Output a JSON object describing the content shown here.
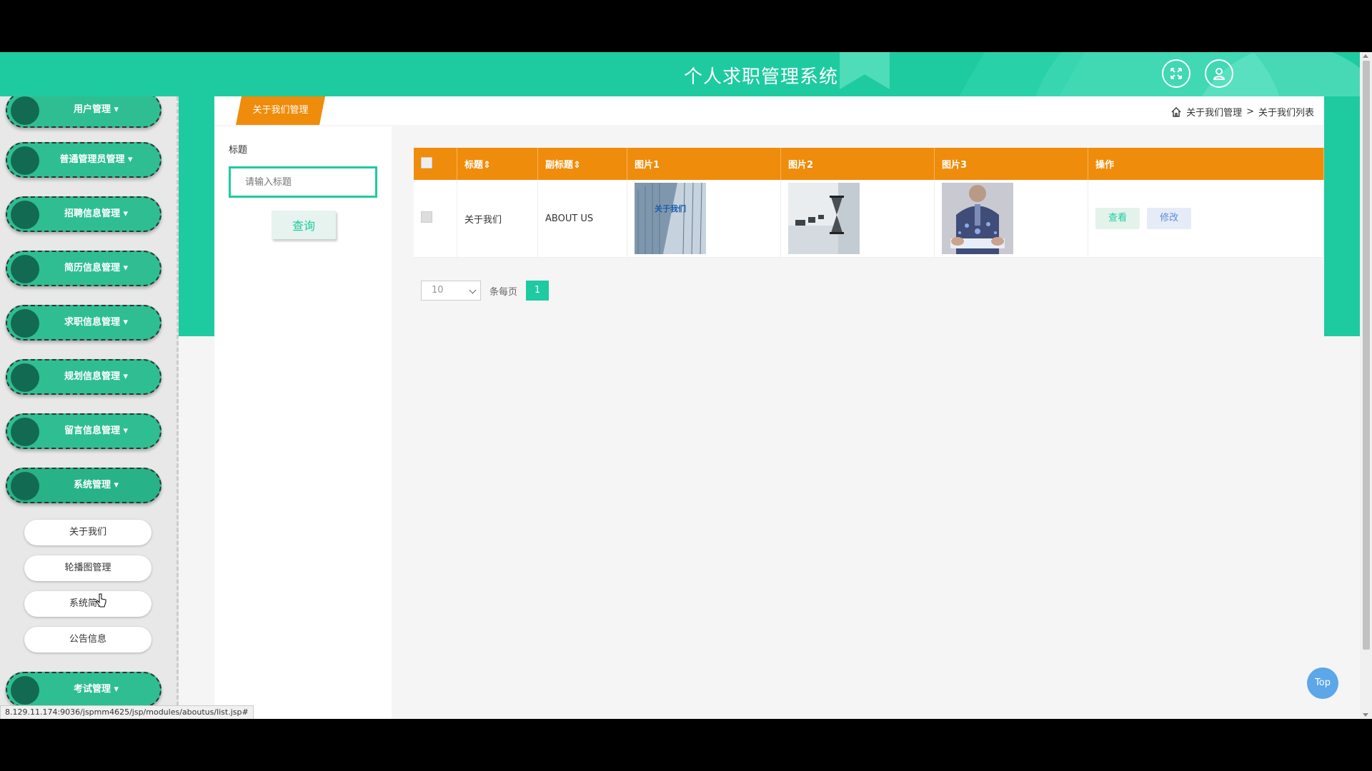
{
  "header": {
    "title": "个人求职管理系统"
  },
  "sidebar": {
    "menus": [
      {
        "label": "用户管理"
      },
      {
        "label": "普通管理员管理"
      },
      {
        "label": "招聘信息管理"
      },
      {
        "label": "简历信息管理"
      },
      {
        "label": "求职信息管理"
      },
      {
        "label": "规划信息管理"
      },
      {
        "label": "留言信息管理"
      },
      {
        "label": "系统管理"
      },
      {
        "label": "考试管理"
      }
    ],
    "submenu": [
      {
        "label": "关于我们"
      },
      {
        "label": "轮播图管理"
      },
      {
        "label": "系统简介"
      },
      {
        "label": "公告信息"
      }
    ]
  },
  "main": {
    "tab": "关于我们管理",
    "breadcrumb": {
      "level1": "关于我们管理",
      "sep": ">",
      "level2": "关于我们列表"
    },
    "filter": {
      "label": "标题",
      "placeholder": "请输入标题",
      "button": "查询"
    },
    "table": {
      "headers": [
        "标题",
        "副标题",
        "图片1",
        "图片2",
        "图片3",
        "操作"
      ],
      "rows": [
        {
          "title": "关于我们",
          "subtitle": "ABOUT US",
          "image1_text": "关于我们",
          "view": "查看",
          "edit": "修改"
        }
      ]
    },
    "pagination": {
      "page_size": "10",
      "per_page_label": "条每页",
      "current_page": "1"
    }
  },
  "top_button": "Top",
  "status_url": "8.129.11.174:9036/jspmm4625/jsp/modules/aboutus/list.jsp#",
  "colors": {
    "primary": "#1ecba0",
    "accent": "#ef8c0b",
    "sidebar_menu": "#2ebe92"
  },
  "icons": [
    "fullscreen-icon",
    "user-icon",
    "home-icon",
    "sort-icon",
    "chevron-down-icon"
  ]
}
